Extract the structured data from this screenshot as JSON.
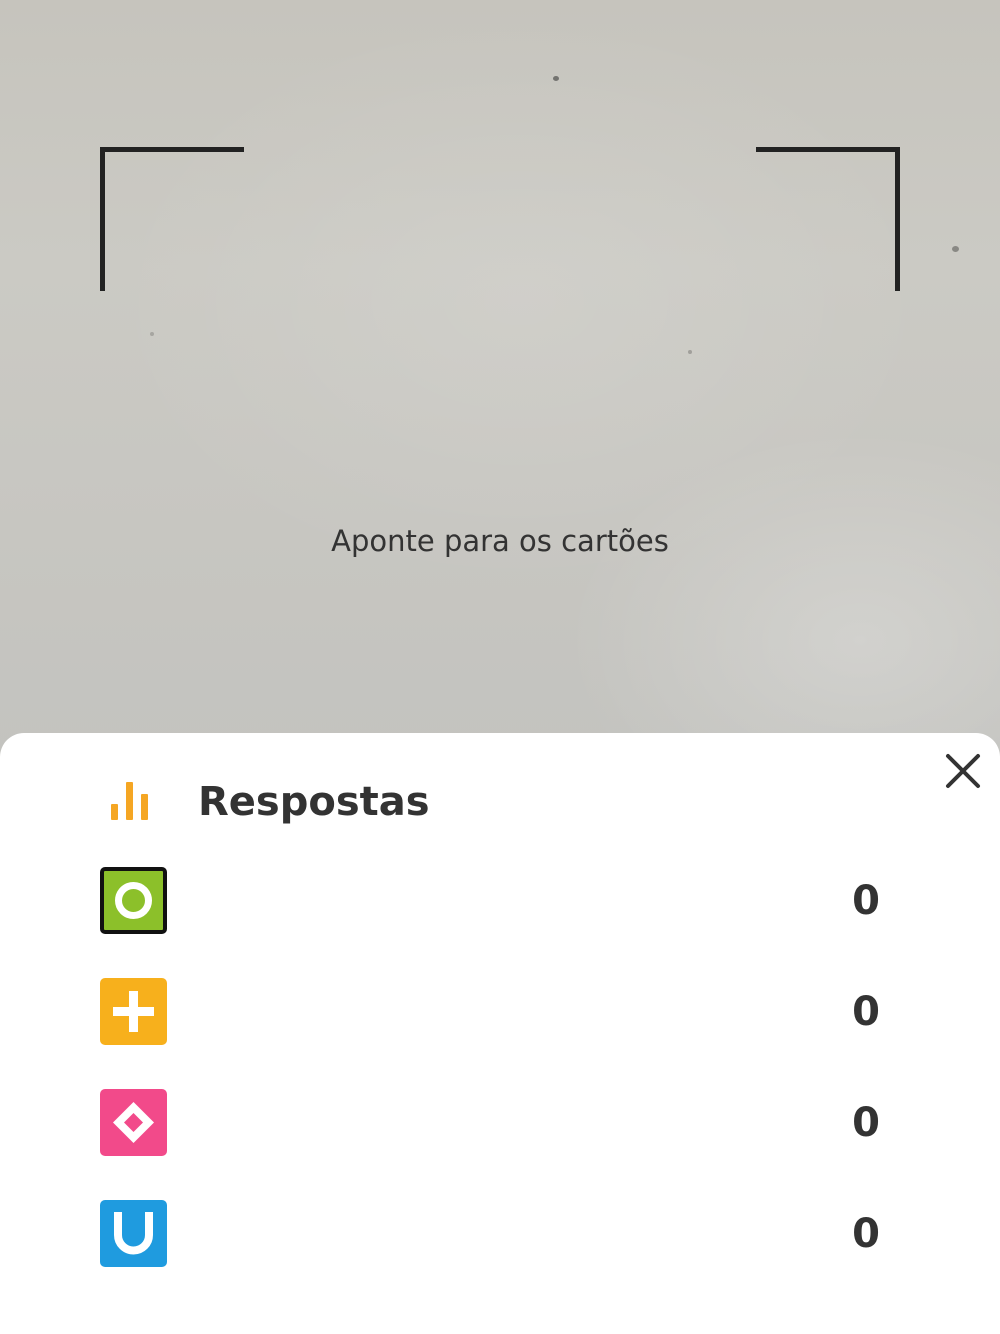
{
  "camera": {
    "hint": "Aponte para os cartões"
  },
  "sheet": {
    "title": "Respostas",
    "icons": {
      "header": "bar-chart-icon",
      "close": "close-icon"
    },
    "colors": {
      "header_icon": "#f5a623",
      "text": "#333333"
    },
    "answers": [
      {
        "icon": "circle-icon",
        "color": "#8cc02a",
        "count": "0"
      },
      {
        "icon": "plus-icon",
        "color": "#f7b01c",
        "count": "0"
      },
      {
        "icon": "diamond-icon",
        "color": "#f24a8a",
        "count": "0"
      },
      {
        "icon": "u-icon",
        "color": "#1f9bdf",
        "count": "0"
      }
    ]
  }
}
